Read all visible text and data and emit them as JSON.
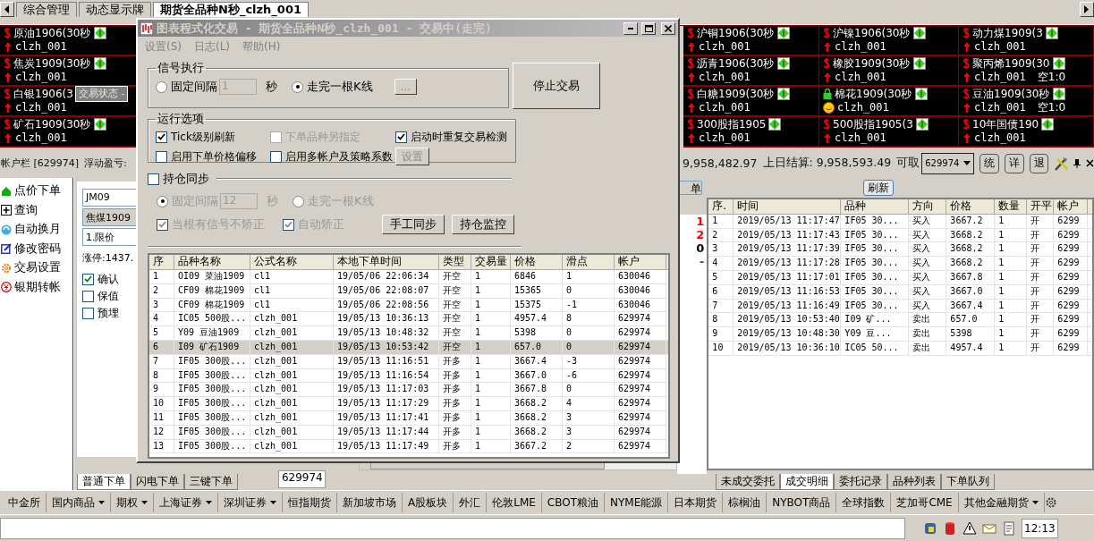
{
  "top_tabs": [
    {
      "label": "综合管理",
      "selected": false
    },
    {
      "label": "动态显示牌",
      "selected": false
    },
    {
      "label": "期货全品种N秒_clzh_001",
      "selected": true
    }
  ],
  "board": {
    "left": [
      {
        "name": "原油1906(30秒",
        "account": "clzh_001",
        "kind": "normal"
      },
      {
        "name": "焦炭1909(30秒",
        "account": "clzh_001",
        "kind": "normal"
      },
      {
        "name": "白银1906(3",
        "account": "clzh_001",
        "kind": "normal"
      },
      {
        "name": "矿石1909(30秒",
        "account": "clzh_001",
        "kind": "normal"
      }
    ],
    "right": [
      {
        "name": "沪铜1906(30秒",
        "account": "clzh_001",
        "kind": "normal"
      },
      {
        "name": "沪镍1906(30秒",
        "account": "clzh_001",
        "kind": "normal"
      },
      {
        "name": "动力煤1909(3",
        "account": "clzh_001",
        "kind": "normal"
      },
      {
        "name": "沥青1906(30秒",
        "account": "clzh_001",
        "kind": "normal"
      },
      {
        "name": "橡胶1909(30秒",
        "account": "clzh_001",
        "kind": "normal"
      },
      {
        "name": "聚丙烯1909(30",
        "account": "clzh_001",
        "position": "空1:0",
        "kind": "normal"
      },
      {
        "name": "白糖1909(30秒",
        "account": "clzh_001",
        "kind": "normal"
      },
      {
        "name": "棉花1909(30秒",
        "account": "clzh_001",
        "kind": "locked"
      },
      {
        "name": "豆油1909(30秒",
        "account": "clzh_001",
        "position": "空1:0",
        "kind": "normal"
      },
      {
        "name": "300股指1905",
        "account": "clzh_001",
        "kind": "normal"
      },
      {
        "name": "500股指1905(3",
        "account": "clzh_001",
        "kind": "normal"
      },
      {
        "name": "10年国债190",
        "account": "clzh_001",
        "kind": "normal"
      }
    ],
    "tooltip": "交易状态 -"
  },
  "account_bar": {
    "account": "帐户栏 [629974]",
    "float_label": "浮动盈亏:",
    "equity": "9,958,482.97",
    "settle": "上日结算: 9,958,593.49",
    "available_label": "可取",
    "account_select": "629974",
    "buttons": [
      "统",
      "详",
      "退"
    ]
  },
  "sidebar": [
    {
      "label": "点价下单",
      "kind": "house"
    },
    {
      "label": "查询",
      "kind": "plus"
    },
    {
      "label": "自动换月",
      "kind": "cycle"
    },
    {
      "label": "修改密码",
      "kind": "edit"
    },
    {
      "label": "交易设置",
      "kind": "gear"
    },
    {
      "label": "银期转帐",
      "kind": "yen"
    }
  ],
  "order_panel": {
    "code": "JM09",
    "name": "焦煤1909",
    "price_type": "1.限价",
    "limit": "涨停:1437.",
    "checks": [
      {
        "label": "确认",
        "checked": true
      },
      {
        "label": "保值",
        "checked": false
      },
      {
        "label": "预埋",
        "checked": false
      }
    ],
    "tabs": [
      {
        "label": "普通下单",
        "selected": true
      },
      {
        "label": "闪电下单",
        "selected": false
      },
      {
        "label": "三键下单",
        "selected": false
      }
    ],
    "account": "629974"
  },
  "fragment": {
    "button": "单",
    "values": [
      {
        "text": "1",
        "color": "#ff0000"
      },
      {
        "text": "2",
        "color": "#ff0000"
      },
      {
        "text": "0",
        "color": "#000000"
      },
      {
        "text": "-",
        "color": "#008000"
      }
    ]
  },
  "trades": {
    "refresh": "刷新",
    "columns": [
      "序.",
      "时间",
      "品种",
      "方向",
      "价格",
      "数量",
      "开平",
      "帐户"
    ],
    "rows": [
      [
        "1",
        "2019/05/13 11:17:47",
        "IF05 30...",
        "买入",
        "3667.2",
        "1",
        "开",
        "6299"
      ],
      [
        "2",
        "2019/05/13 11:17:43",
        "IF05 30...",
        "买入",
        "3668.2",
        "1",
        "开",
        "6299"
      ],
      [
        "3",
        "2019/05/13 11:17:39",
        "IF05 30...",
        "买入",
        "3668.2",
        "1",
        "开",
        "6299"
      ],
      [
        "4",
        "2019/05/13 11:17:28",
        "IF05 30...",
        "买入",
        "3668.2",
        "1",
        "开",
        "6299"
      ],
      [
        "5",
        "2019/05/13 11:17:01",
        "IF05 30...",
        "买入",
        "3667.8",
        "1",
        "开",
        "6299"
      ],
      [
        "6",
        "2019/05/13 11:16:53",
        "IF05 30...",
        "买入",
        "3667.0",
        "1",
        "开",
        "6299"
      ],
      [
        "7",
        "2019/05/13 11:16:49",
        "IF05 30...",
        "买入",
        "3667.4",
        "1",
        "开",
        "6299"
      ],
      [
        "8",
        "2019/05/13 10:53:40",
        "I09 矿...",
        "卖出",
        "657.0",
        "1",
        "开",
        "6299"
      ],
      [
        "9",
        "2019/05/13 10:48:30",
        "Y09 豆...",
        "卖出",
        "5398",
        "1",
        "开",
        "6299"
      ],
      [
        "10",
        "2019/05/13 10:36:10",
        "IC05 50...",
        "卖出",
        "4957.4",
        "1",
        "开",
        "6299"
      ]
    ],
    "tabs": [
      {
        "label": "未成交委托",
        "selected": false
      },
      {
        "label": "成交明细",
        "selected": true
      },
      {
        "label": "委托记录",
        "selected": false
      },
      {
        "label": "品种列表",
        "selected": false
      },
      {
        "label": "下单队列",
        "selected": false
      }
    ]
  },
  "toolbar": [
    {
      "label": "中金所",
      "dropdown": false
    },
    {
      "label": "国内商品",
      "dropdown": true
    },
    {
      "label": "期权",
      "dropdown": true
    },
    {
      "label": "上海证券",
      "dropdown": true
    },
    {
      "label": "深圳证券",
      "dropdown": true
    },
    {
      "label": "恒指期货",
      "dropdown": false
    },
    {
      "label": "新加坡市场",
      "dropdown": false
    },
    {
      "label": "A股板块",
      "dropdown": false
    },
    {
      "label": "外汇",
      "dropdown": false
    },
    {
      "label": "伦敦LME",
      "dropdown": false
    },
    {
      "label": "CBOT粮油",
      "dropdown": false
    },
    {
      "label": "NYME能源",
      "dropdown": false
    },
    {
      "label": "日本期货",
      "dropdown": false
    },
    {
      "label": "棕榈油",
      "dropdown": false
    },
    {
      "label": "NYBOT商品",
      "dropdown": false
    },
    {
      "label": "全球指数",
      "dropdown": false
    },
    {
      "label": "芝加哥CME",
      "dropdown": false
    },
    {
      "label": "其他金融期货",
      "dropdown": true
    }
  ],
  "status_bar": {
    "clock": "12:13"
  },
  "dialog": {
    "title": "图表程式化交易 - 期货全品种N秒_clzh_001 - 交易中(走完)",
    "active": false,
    "menu": [
      "设置(S)",
      "日志(L)",
      "帮助(H)"
    ],
    "signal": {
      "title": "信号执行",
      "interval": {
        "label": "固定间隔",
        "selected": false,
        "value": "1",
        "unit": "秒"
      },
      "bar": {
        "label": "走完一根K线",
        "selected": true
      },
      "more": "..."
    },
    "stop_button": "停止交易",
    "run_options": {
      "title": "运行选项",
      "checks": [
        {
          "label": "Tick级别刷新",
          "checked": true,
          "disabled": false
        },
        {
          "label": "下单品种另指定",
          "checked": false,
          "disabled": true
        },
        {
          "label": "启动时重复交易检测",
          "checked": true,
          "disabled": false
        },
        {
          "label": "启用下单价格偏移",
          "checked": false,
          "disabled": false
        },
        {
          "label": "启用多帐户及策略系数",
          "checked": false,
          "disabled": false
        }
      ],
      "settings": "设置"
    },
    "sync": {
      "label": "持仓同步",
      "checked": false,
      "interval": {
        "label": "固定间隔",
        "selected": true,
        "value": "12",
        "unit": "秒"
      },
      "bar": {
        "label": "走完一根K线",
        "selected": false
      },
      "checks": [
        {
          "label": "当根有信号不矫正",
          "checked": true
        },
        {
          "label": "自动矫正",
          "checked": true
        }
      ],
      "buttons": [
        "手工同步",
        "持仓监控"
      ]
    },
    "orders": {
      "columns": [
        "序",
        "品种名称",
        "公式名称",
        "本地下单时间",
        "类型",
        "交易量",
        "价格",
        "滑点",
        "帐户"
      ],
      "rows": [
        {
          "selected": false,
          "cells": [
            "1",
            "OI09 菜油1909",
            "cl1",
            "19/05/06 22:06:34",
            "开空",
            "1",
            "6846",
            "1",
            "630046"
          ]
        },
        {
          "selected": false,
          "cells": [
            "2",
            "CF09 棉花1909",
            "cl1",
            "19/05/06 22:08:07",
            "开空",
            "1",
            "15365",
            "0",
            "630046"
          ]
        },
        {
          "selected": false,
          "cells": [
            "3",
            "CF09 棉花1909",
            "cl1",
            "19/05/06 22:08:56",
            "开空",
            "1",
            "15375",
            "-1",
            "630046"
          ]
        },
        {
          "selected": false,
          "cells": [
            "4",
            "IC05 500股...",
            "clzh_001",
            "19/05/13 10:36:13",
            "开空",
            "1",
            "4957.4",
            "8",
            "629974"
          ]
        },
        {
          "selected": false,
          "cells": [
            "5",
            "Y09 豆油1909",
            "clzh_001",
            "19/05/13 10:48:32",
            "开空",
            "1",
            "5398",
            "0",
            "629974"
          ]
        },
        {
          "selected": true,
          "cells": [
            "6",
            "I09 矿石1909",
            "clzh_001",
            "19/05/13 10:53:42",
            "开空",
            "1",
            "657.0",
            "0",
            "629974"
          ]
        },
        {
          "selected": false,
          "cells": [
            "7",
            "IF05 300股...",
            "clzh_001",
            "19/05/13 11:16:51",
            "开多",
            "1",
            "3667.4",
            "-3",
            "629974"
          ]
        },
        {
          "selected": false,
          "cells": [
            "8",
            "IF05 300股...",
            "clzh_001",
            "19/05/13 11:16:54",
            "开多",
            "1",
            "3667.0",
            "-6",
            "629974"
          ]
        },
        {
          "selected": false,
          "cells": [
            "9",
            "IF05 300股...",
            "clzh_001",
            "19/05/13 11:17:03",
            "开多",
            "1",
            "3667.8",
            "0",
            "629974"
          ]
        },
        {
          "selected": false,
          "cells": [
            "10",
            "IF05 300股...",
            "clzh_001",
            "19/05/13 11:17:29",
            "开多",
            "1",
            "3668.2",
            "4",
            "629974"
          ]
        },
        {
          "selected": false,
          "cells": [
            "11",
            "IF05 300股...",
            "clzh_001",
            "19/05/13 11:17:41",
            "开多",
            "1",
            "3668.2",
            "3",
            "629974"
          ]
        },
        {
          "selected": false,
          "cells": [
            "12",
            "IF05 300股...",
            "clzh_001",
            "19/05/13 11:17:44",
            "开多",
            "1",
            "3668.2",
            "3",
            "629974"
          ]
        },
        {
          "selected": false,
          "cells": [
            "13",
            "IF05 300股...",
            "clzh_001",
            "19/05/13 11:17:49",
            "开多",
            "1",
            "3667.2",
            "2",
            "629974"
          ]
        }
      ]
    }
  }
}
